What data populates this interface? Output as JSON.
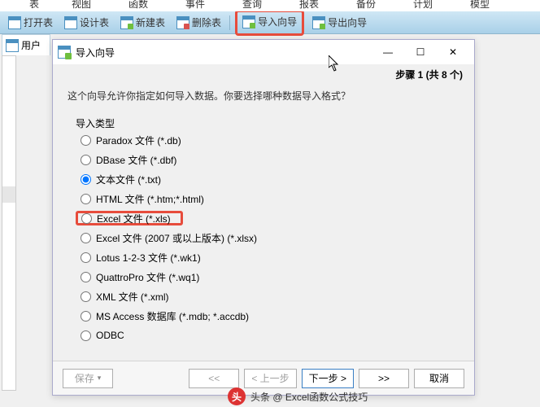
{
  "menubar": {
    "items": [
      "表",
      "视图",
      "函数",
      "事件",
      "查询",
      "报表",
      "备份",
      "计划",
      "模型"
    ]
  },
  "toolbar": {
    "open": "打开表",
    "design": "设计表",
    "new": "新建表",
    "delete": "删除表",
    "import": "导入向导",
    "export": "导出向导"
  },
  "left_tab": "用户",
  "dialog": {
    "title": "导入向导",
    "window_buttons": {
      "min": "—",
      "max": "☐",
      "close": "✕"
    },
    "step_label": "步骤 1 (共 8 个)",
    "prompt": "这个向导允许你指定如何导入数据。你要选择哪种数据导入格式？",
    "group_label": "导入类型",
    "options": [
      {
        "label": "Paradox 文件 (*.db)",
        "checked": false
      },
      {
        "label": "DBase 文件 (*.dbf)",
        "checked": false
      },
      {
        "label": "文本文件 (*.txt)",
        "checked": true
      },
      {
        "label": "HTML 文件 (*.htm;*.html)",
        "checked": false
      },
      {
        "label": "Excel 文件 (*.xls)",
        "checked": false,
        "highlight": true
      },
      {
        "label": "Excel 文件 (2007 或以上版本) (*.xlsx)",
        "checked": false
      },
      {
        "label": "Lotus 1-2-3 文件 (*.wk1)",
        "checked": false
      },
      {
        "label": "QuattroPro 文件 (*.wq1)",
        "checked": false
      },
      {
        "label": "XML 文件 (*.xml)",
        "checked": false
      },
      {
        "label": "MS Access 数据库 (*.mdb; *.accdb)",
        "checked": false
      },
      {
        "label": "ODBC",
        "checked": false
      }
    ],
    "footer": {
      "save": "保存",
      "first": "<<",
      "prev": "< 上一步",
      "next": "下一步 >",
      "last": ">>",
      "cancel": "取消"
    }
  },
  "watermark": "头条 @ Excel函数公式技巧"
}
